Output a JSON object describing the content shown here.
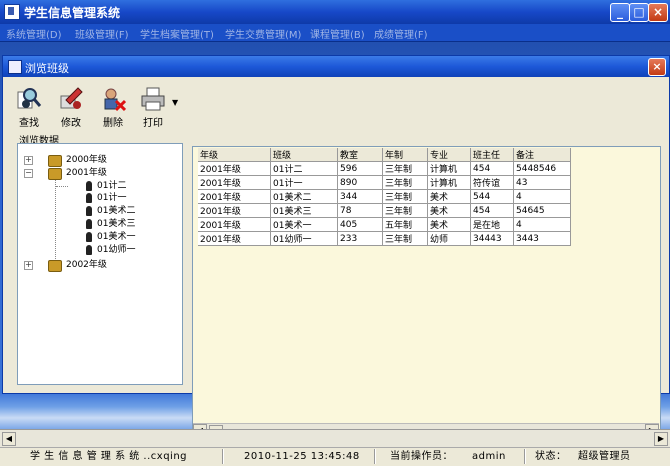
{
  "app": {
    "title": "学生信息管理系统"
  },
  "menu": [
    "系统管理(D)",
    "班级管理(F)",
    "学生档案管理(T)",
    "学生交费管理(M)",
    "课程管理(B)",
    "成绩管理(F)"
  ],
  "child": {
    "title": "浏览班级",
    "toolbar": {
      "find": "查找",
      "edit": "修改",
      "delete": "删除",
      "print": "打印"
    },
    "tree_label": "浏览数据",
    "tree": [
      {
        "label": "2000年级"
      },
      {
        "label": "2001年级",
        "children": [
          "01计二",
          "01计一",
          "01美术二",
          "01美术三",
          "01美术一",
          "01幼师一"
        ]
      },
      {
        "label": "2002年级"
      }
    ],
    "grid": {
      "columns": [
        "年级",
        "班级",
        "教室",
        "年制",
        "专业",
        "班主任",
        "备注"
      ],
      "rows": [
        [
          "2001年级",
          "01计二",
          "596",
          "三年制",
          "计算机",
          "454",
          "5448546"
        ],
        [
          "2001年级",
          "01计一",
          "890",
          "三年制",
          "计算机",
          "符传谊",
          "43"
        ],
        [
          "2001年级",
          "01美术二",
          "344",
          "三年制",
          "美术",
          "544",
          "4"
        ],
        [
          "2001年级",
          "01美术三",
          "78",
          "三年制",
          "美术",
          "454",
          "54645"
        ],
        [
          "2001年级",
          "01美术一",
          "405",
          "五年制",
          "美术",
          "是在地",
          "4"
        ],
        [
          "2001年级",
          "01幼师一",
          "233",
          "三年制",
          "幼师",
          "34443",
          "3443"
        ]
      ]
    }
  },
  "status": {
    "app_name": "学 生 信 息 管 理 系 统 ..cxqing",
    "datetime": "2010-11-25 13:45:48",
    "operator_label": "当前操作员：",
    "operator": "admin",
    "state_label": "状态：",
    "state": "超级管理员"
  }
}
